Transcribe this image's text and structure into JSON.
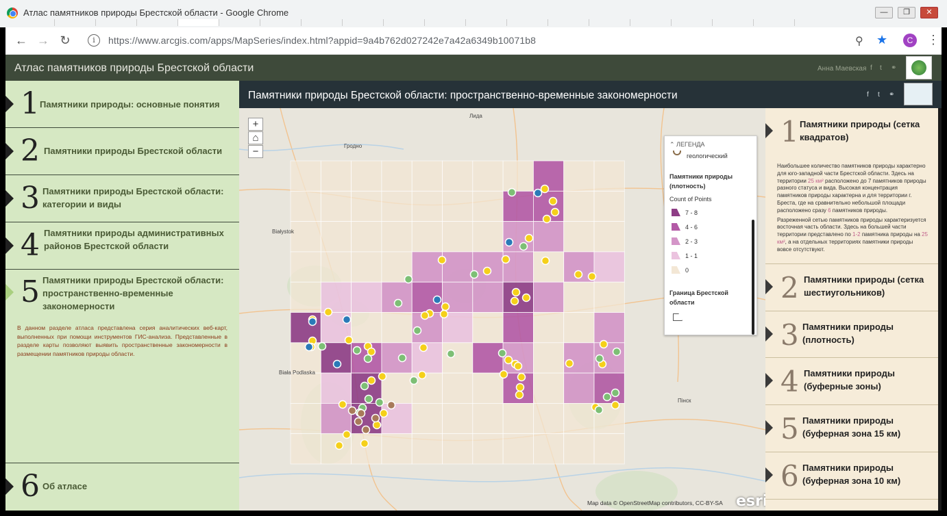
{
  "browser": {
    "window_title": "Атлас памятников природы Брестской области - Google Chrome",
    "url_host": "https://www.arcgis.com",
    "url_path": "/apps/MapSeries/index.html?appid=9a4b762d027242e7a42a6349b10071b8",
    "profile_initial": "C",
    "win_min": "—",
    "win_max": "❐",
    "win_close": "✕"
  },
  "app": {
    "title": "Атлас памятников природы Брестской области",
    "author": "Анна Маевская"
  },
  "left_nav": [
    {
      "num": "1",
      "label": "Памятники природы: основные понятия"
    },
    {
      "num": "2",
      "label": "Памятники природы Брестской области"
    },
    {
      "num": "3",
      "label": "Памятники природы Брестской области: категории и виды"
    },
    {
      "num": "4",
      "label": "Памятники природы административных районов Брестской области"
    },
    {
      "num": "5",
      "label": "Памятники природы Брестской области: пространственно-временные закономерности"
    },
    {
      "num": "6",
      "label": "Об атласе"
    }
  ],
  "left_description": "В данном разделе атласа представлена серия аналитических веб-карт, выполненных при помощи инструментов ГИС-анализа. Представленные в разделе карты позволяют выявить пространственные закономерности в размещении памятников природы области.",
  "map": {
    "title": "Памятники природы Брестской области: пространственно-временные закономерности",
    "zoom_in": "+",
    "zoom_out": "−",
    "home": "⌂",
    "attribution": "Map data © OpenStreetMap contributors, CC-BY-SA",
    "esri": "esri",
    "place_labels": [
      "Лида",
      "Гродно",
      "Białystok",
      "Biała Podlaska",
      "Пінск"
    ]
  },
  "legend": {
    "header": "ЛЕГЕНДА",
    "geo_label": "геологический",
    "density_title": "Памятники природы (плотность)",
    "count_label": "Count of Points",
    "classes": [
      {
        "label": "7 - 8",
        "color": "#8e3d86"
      },
      {
        "label": "4 - 6",
        "color": "#b35aa6"
      },
      {
        "label": "2 - 3",
        "color": "#d495c8"
      },
      {
        "label": "1 - 1",
        "color": "#ebc3df"
      },
      {
        "label": "0",
        "color": "#f3e7d5"
      }
    ],
    "boundary_title": "Граница Брестской области"
  },
  "right_nav": [
    {
      "num": "1",
      "label": "Памятники природы (сетка квадратов)"
    },
    {
      "num": "2",
      "label": "Памятники природы (сетка шестиугольников)"
    },
    {
      "num": "3",
      "label": "Памятники природы (плотность)"
    },
    {
      "num": "4",
      "label": "Памятники природы (буферные зоны)"
    },
    {
      "num": "5",
      "label": "Памятники природы (буферная зона 15 км)"
    },
    {
      "num": "6",
      "label": "Памятники природы (буферная зона 10 км)"
    }
  ],
  "right_text": {
    "p1_a": "Наибольшее количество памятников природы характерно для юго-западной части Брестской области. Здесь на территории ",
    "p1_h1": "25 км²",
    "p1_b": " расположено до 7 памятников природы разного статуса и вида. Высокая концентрация памятников природы характерна и для территории г. Бреста, где на сравнительно небольшой площади расположено сразу ",
    "p1_h2": "6",
    "p1_c": " памятников природы.",
    "p2_a": "Разреженной сетью памятников природы характеризуется восточная часть области. Здесь на большей части территории представлено по ",
    "p2_h1": "1-2",
    "p2_b": " памятника природы на ",
    "p2_h2": "25 км²",
    "p2_c": ", а на отдельных территориях памятники природы вовсе отсутствуют."
  },
  "colors": {
    "header_bg": "#3e4a3a",
    "left_bg": "#d6e8c3",
    "right_bg": "#f6ecd9",
    "map_bar": "#263238"
  }
}
